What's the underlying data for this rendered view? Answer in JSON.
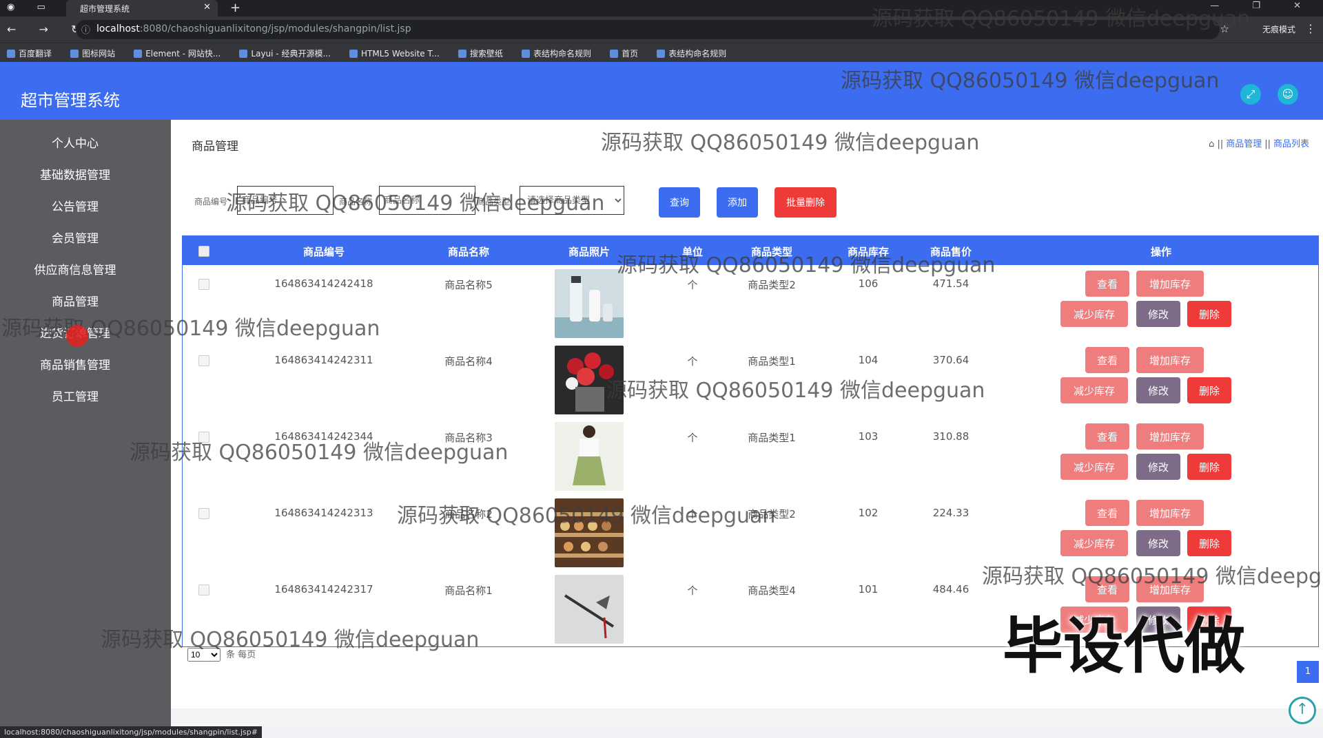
{
  "browser": {
    "tab_title": "超市管理系统",
    "url_host": "localhost",
    "url_path": ":8080/chaoshiguanlixitong/jsp/modules/shangpin/list.jsp",
    "incognito_label": "无痕模式",
    "bookmarks": [
      "百度翻译",
      "图标网站",
      "Element - 网站快...",
      "Layui - 经典开源模...",
      "HTML5 Website T...",
      "搜索壁纸",
      "表结构命名规则",
      "首页",
      "表结构命名规则"
    ],
    "status_url": "localhost:8080/chaoshiguanlixitong/jsp/modules/shangpin/list.jsp#"
  },
  "app": {
    "title": "超市管理系统",
    "accent": "#3c6df0"
  },
  "sidebar": {
    "items": [
      "个人中心",
      "基础数据管理",
      "公告管理",
      "会员管理",
      "供应商信息管理",
      "商品管理",
      "进货订单管理",
      "商品销售管理",
      "员工管理"
    ]
  },
  "page": {
    "title": "商品管理",
    "breadcrumb": [
      "商品管理",
      "商品列表"
    ]
  },
  "search": {
    "field1_label": "商品编号",
    "field1_placeholder": "商品编号",
    "field2_label": "商品名称",
    "field2_placeholder": "商品名称",
    "select_label": "商品类型",
    "select_value": "请选择商品类型",
    "query_label": "查询",
    "add_label": "添加",
    "batch_delete_label": "批量删除"
  },
  "table": {
    "headers": [
      "商品编号",
      "商品名称",
      "商品照片",
      "单位",
      "商品类型",
      "商品库存",
      "商品售价",
      "操作"
    ],
    "rows": [
      {
        "code": "164863414242418",
        "name": "商品名称5",
        "unit": "个",
        "type": "商品类型2",
        "stock": "106",
        "price": "471.54",
        "photo": "cosmetics"
      },
      {
        "code": "164863414242311",
        "name": "商品名称4",
        "unit": "个",
        "type": "商品类型1",
        "stock": "104",
        "price": "370.64",
        "photo": "flowers"
      },
      {
        "code": "164863414242344",
        "name": "商品名称3",
        "unit": "个",
        "type": "商品类型1",
        "stock": "103",
        "price": "310.88",
        "photo": "dress"
      },
      {
        "code": "164863414242313",
        "name": "商品名称2",
        "unit": "个",
        "type": "商品类型2",
        "stock": "102",
        "price": "224.33",
        "photo": "shelves"
      },
      {
        "code": "164863414242317",
        "name": "商品名称1",
        "unit": "个",
        "type": "商品类型4",
        "stock": "101",
        "price": "484.46",
        "photo": "tool"
      }
    ],
    "actions": {
      "view": "查看",
      "add_stock": "增加库存",
      "reduce_stock": "减少库存",
      "edit": "修改",
      "delete": "删除"
    }
  },
  "pagination": {
    "page_size": "10",
    "page_size_suffix": "条 每页",
    "current_page": "1"
  },
  "watermark": {
    "text": "源码获取 QQ86050149 微信deepguan",
    "big_text": "毕设代做"
  }
}
